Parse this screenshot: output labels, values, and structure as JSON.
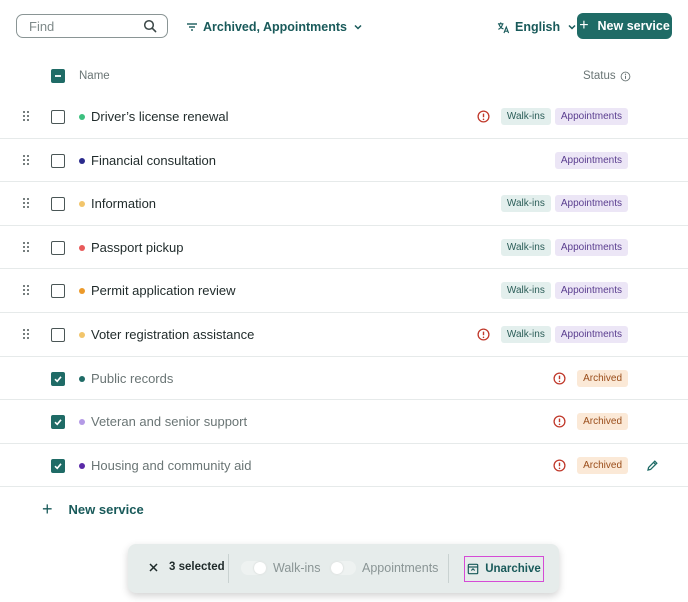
{
  "toolbar": {
    "search_placeholder": "Find",
    "filter_label": "Archived, Appointments",
    "language_label": "English",
    "new_service_label": "New service"
  },
  "table": {
    "col_name": "Name",
    "col_status": "Status",
    "badge_walkins": "Walk-ins",
    "badge_appointments": "Appointments",
    "badge_archived": "Archived",
    "rows": [
      {
        "name": "Driver’s license renewal",
        "dot": "#3cc07f",
        "checked": false,
        "archived": false,
        "alert": true,
        "walkins": true,
        "appointments": true
      },
      {
        "name": "Financial consultation",
        "dot": "#2a2a8c",
        "checked": false,
        "archived": false,
        "alert": false,
        "walkins": false,
        "appointments": true
      },
      {
        "name": "Information",
        "dot": "#f2c56b",
        "checked": false,
        "archived": false,
        "alert": false,
        "walkins": true,
        "appointments": true
      },
      {
        "name": "Passport pickup",
        "dot": "#e85a5a",
        "checked": false,
        "archived": false,
        "alert": false,
        "walkins": true,
        "appointments": true
      },
      {
        "name": "Permit application review",
        "dot": "#ec9a2a",
        "checked": false,
        "archived": false,
        "alert": false,
        "walkins": true,
        "appointments": true
      },
      {
        "name": "Voter registration assistance",
        "dot": "#f2c56b",
        "checked": false,
        "archived": false,
        "alert": true,
        "walkins": true,
        "appointments": true
      },
      {
        "name": "Public records",
        "dot": "#1f6b66",
        "checked": true,
        "archived": true,
        "alert": true
      },
      {
        "name": "Veteran and senior support",
        "dot": "#b49ae6",
        "checked": true,
        "archived": true,
        "alert": true
      },
      {
        "name": "Housing and community aid",
        "dot": "#5a2aa8",
        "checked": true,
        "archived": true,
        "alert": true,
        "edit": true
      }
    ]
  },
  "add_row_label": "New service",
  "action_bar": {
    "selected_label": "3 selected",
    "walkins_label": "Walk-ins",
    "appointments_label": "Appointments",
    "unarchive_label": "Unarchive"
  },
  "colors": {
    "accent": "#1f6b66",
    "alert": "#c0392b",
    "highlight": "#d54bd6"
  }
}
